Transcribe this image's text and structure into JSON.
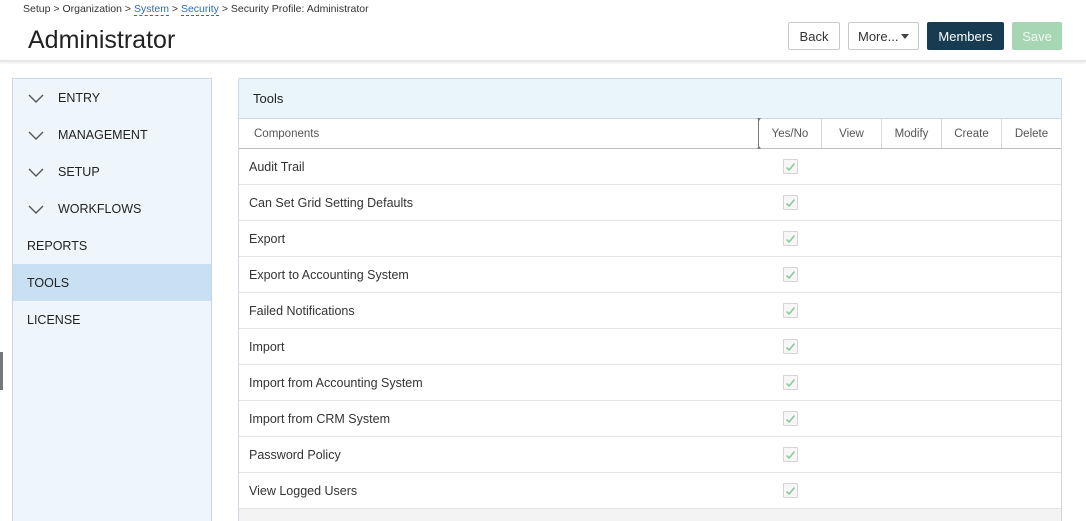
{
  "breadcrumb": {
    "setup": "Setup",
    "organization": "Organization",
    "system": "System",
    "security": "Security",
    "current": "Security Profile: Administrator",
    "separator": ">"
  },
  "page": {
    "title": "Administrator"
  },
  "actions": {
    "back": "Back",
    "more": "More...",
    "members": "Members",
    "save": "Save"
  },
  "sidebar": {
    "items": [
      {
        "label": "ENTRY",
        "type": "group",
        "icon": "chevron-down-icon"
      },
      {
        "label": "MANAGEMENT",
        "type": "group",
        "icon": "chevron-down-icon"
      },
      {
        "label": "SETUP",
        "type": "group",
        "icon": "chevron-down-icon"
      },
      {
        "label": "WORKFLOWS",
        "type": "group",
        "icon": "chevron-down-icon"
      },
      {
        "label": "REPORTS",
        "type": "leaf"
      },
      {
        "label": "TOOLS",
        "type": "leaf",
        "active": true
      },
      {
        "label": "LICENSE",
        "type": "leaf"
      }
    ]
  },
  "panel": {
    "title": "Tools",
    "columns": {
      "components": "Components",
      "yes_no": "Yes/No",
      "view": "View",
      "modify": "Modify",
      "create": "Create",
      "delete": "Delete"
    },
    "rows": [
      {
        "name": "Audit Trail",
        "yes_no": true
      },
      {
        "name": "Can Set Grid Setting Defaults",
        "yes_no": true
      },
      {
        "name": "Export",
        "yes_no": true
      },
      {
        "name": "Export to Accounting System",
        "yes_no": true
      },
      {
        "name": "Failed Notifications",
        "yes_no": true
      },
      {
        "name": "Import",
        "yes_no": true
      },
      {
        "name": "Import from Accounting System",
        "yes_no": true
      },
      {
        "name": "Import from CRM System",
        "yes_no": true
      },
      {
        "name": "Password Policy",
        "yes_no": true
      },
      {
        "name": "View Logged Users",
        "yes_no": true
      }
    ]
  },
  "colors": {
    "members_bg": "#173c52",
    "save_bg": "#a6d6b3",
    "sidebar_bg": "#eef6fb",
    "sidebar_active": "#c9e0f2",
    "panel_header_bg": "#eaf4fb",
    "check_color": "#8ec99a",
    "link_color": "#2a6db5"
  }
}
